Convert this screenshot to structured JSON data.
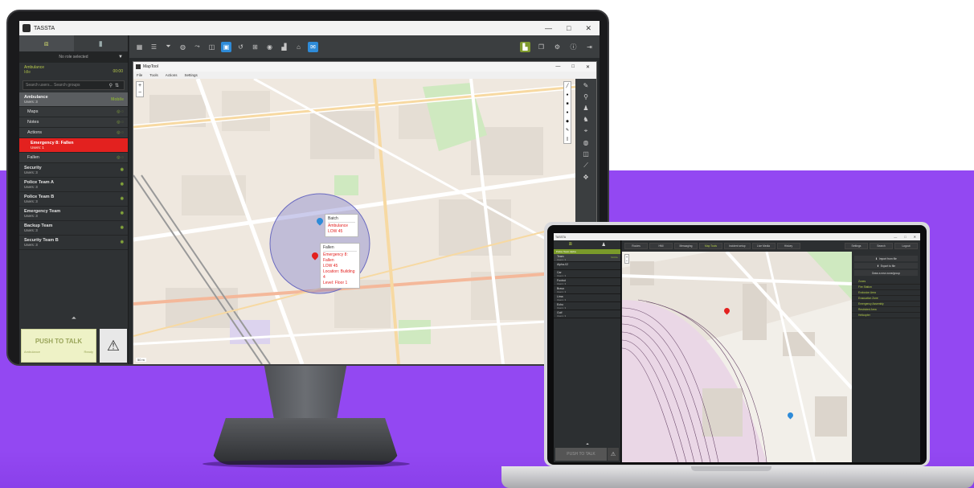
{
  "app": {
    "title": "TASSTA",
    "window_controls": [
      "—",
      "□",
      "✕"
    ]
  },
  "desktop": {
    "left_panel": {
      "role": "No role selected",
      "status_line1": "Ambulance",
      "status_line2": "Idle",
      "status_right": "00:00",
      "search_placeholder": "Search users... Search groups",
      "groups": [
        {
          "name": "Ambulance",
          "sub": "Users: 3",
          "right": "Mobile",
          "kind": "header"
        },
        {
          "name": "Maps",
          "kind": "sub-item"
        },
        {
          "name": "Notes",
          "kind": "sub-item"
        },
        {
          "name": "Actions",
          "kind": "sub-item"
        },
        {
          "name": "Emergency 8: Fallen",
          "sub": "Users: 1",
          "kind": "emergency"
        },
        {
          "name": "Fallen",
          "kind": "sub-item"
        },
        {
          "name": "Security",
          "sub": "Users: 3",
          "kind": "tall"
        },
        {
          "name": "Police Team A",
          "sub": "Users: 3",
          "kind": "tall"
        },
        {
          "name": "Police Team B",
          "sub": "Users: 3",
          "kind": "tall"
        },
        {
          "name": "Emergency Team",
          "sub": "Users: 3",
          "kind": "tall"
        },
        {
          "name": "Backup Team",
          "sub": "Users: 3",
          "kind": "tall"
        },
        {
          "name": "Security Team B",
          "sub": "Users: 3",
          "kind": "tall"
        }
      ],
      "ptt_label": "PUSH TO TALK",
      "ptt_left": "Ambulance",
      "ptt_right": "Ready"
    },
    "map_window": {
      "title": "MapTool",
      "menu": [
        "File",
        "Tools",
        "Actions",
        "Settings"
      ],
      "popup_batch": {
        "title": "Batch",
        "lines": [
          "Ambulance",
          "LOW 45"
        ]
      },
      "popup_fallen": {
        "title": "Fallen",
        "lines": [
          "Emergency 8: Fallen",
          "LOW 45",
          "Location: Building 4",
          "Level: Floor 1"
        ]
      },
      "scale": "50 m"
    }
  },
  "laptop": {
    "title": "TASSTA",
    "role": "Police Team Alpha",
    "nav": [
      "Routes",
      "HMI",
      "Messaging",
      "Map Tools",
      "Incident setup",
      "Live Media",
      "History"
    ],
    "nav_active": "Map Tools",
    "nav_right": [
      "Settings",
      "Search",
      "Logout"
    ],
    "rows": [
      {
        "name": "Team",
        "sub": "Users: 3",
        "right": "Mobile"
      },
      {
        "name": "Alpha-02",
        "sub": ""
      },
      {
        "name": "Car",
        "sub": "Users: 3"
      },
      {
        "name": "Foxtrot",
        "sub": "Users: 3"
      },
      {
        "name": "Bravo",
        "sub": "Users: 3"
      },
      {
        "name": "Lima",
        "sub": "Users: 3"
      },
      {
        "name": "Echo",
        "sub": "Users: 3"
      },
      {
        "name": "Golf",
        "sub": "Users: 3"
      }
    ],
    "right_buttons": [
      "Import from file",
      "Export to file",
      "Draw a new zone/group"
    ],
    "right_list": [
      "Zones",
      "Fire Station",
      "Exclusion Area",
      "Evacuation Zone",
      "Emergency Assembly",
      "Restricted Area",
      "Helicopter"
    ],
    "ptt_label": "PUSH TO TALK"
  },
  "colors": {
    "purple": "#9348f2",
    "accent_green": "#b6c84a",
    "emergency_red": "#e3211f",
    "tool_blue": "#2e8bd8"
  }
}
